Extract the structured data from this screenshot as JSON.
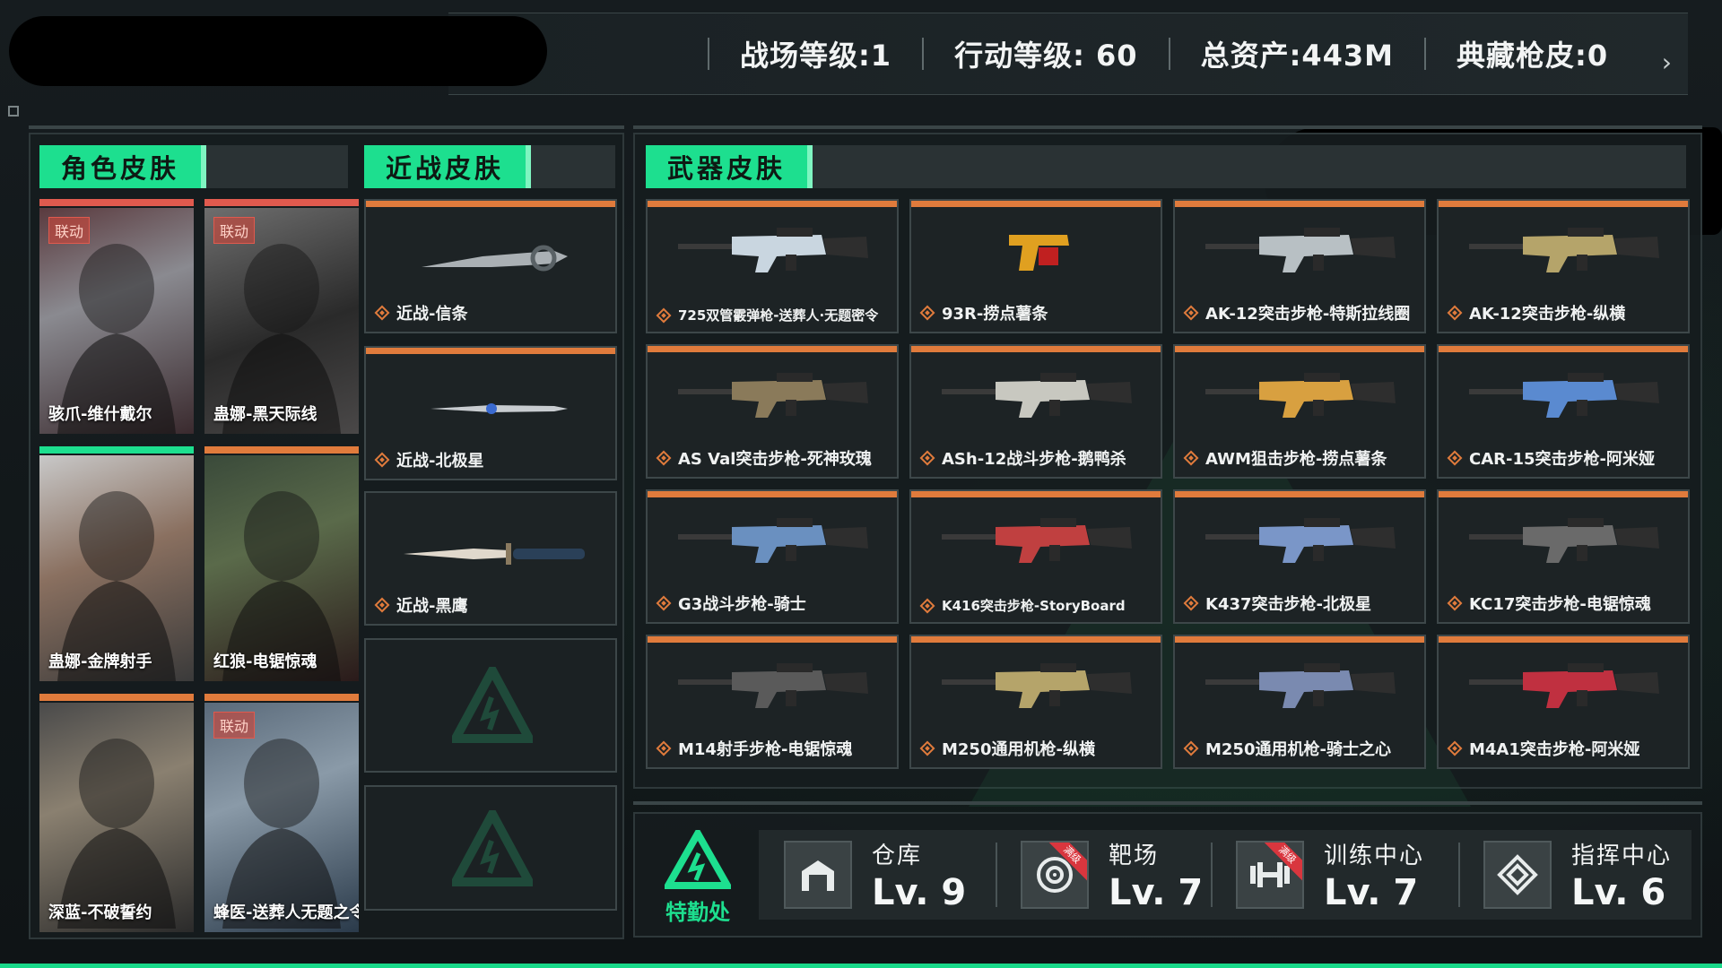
{
  "top_stats": [
    {
      "label": "战场等级:1"
    },
    {
      "label": "行动等级: 60"
    },
    {
      "label": "总资产:443M"
    },
    {
      "label": "典藏枪皮:0"
    }
  ],
  "sections": {
    "character": "角色皮肤",
    "melee": "近战皮肤",
    "weapon": "武器皮肤"
  },
  "characters": [
    {
      "name": "骇爪-维什戴尔",
      "badge": "联动",
      "strip": "#e05a4e"
    },
    {
      "name": "蛊娜-黑天际线",
      "badge": "联动",
      "strip": "#e05a4e"
    },
    {
      "name": "蛊娜-金牌射手",
      "badge": "",
      "strip": "#1ddf8f"
    },
    {
      "name": "红狼-电锯惊魂",
      "badge": "",
      "strip": "#e07b3c"
    },
    {
      "name": "深蓝-不破誓约",
      "badge": "",
      "strip": "#e07b3c"
    },
    {
      "name": "蜂医-送葬人无题之令",
      "badge": "联动",
      "strip": "#e07b3c"
    }
  ],
  "melee": [
    {
      "name": "近战-信条"
    },
    {
      "name": "近战-北极星"
    },
    {
      "name": "近战-黑鹰"
    }
  ],
  "weapons": [
    {
      "name": "725双管霰弹枪-送葬人·无题密令",
      "color": "#c9d6e0"
    },
    {
      "name": "93R-捞点薯条",
      "color": "#e0a020"
    },
    {
      "name": "AK-12突击步枪-特斯拉线圈",
      "color": "#b8c0c4"
    },
    {
      "name": "AK-12突击步枪-纵横",
      "color": "#b5a46a"
    },
    {
      "name": "AS Val突击步枪-死神玫瑰",
      "color": "#8a7a5a"
    },
    {
      "name": "ASh-12战斗步枪-鹅鸭杀",
      "color": "#c8c8c0"
    },
    {
      "name": "AWM狙击步枪-捞点薯条",
      "color": "#d8a040"
    },
    {
      "name": "CAR-15突击步枪-阿米娅",
      "color": "#5a8ad0"
    },
    {
      "name": "G3战斗步枪-骑士",
      "color": "#6a90c0"
    },
    {
      "name": "K416突击步枪-StoryBoard",
      "color": "#c04040"
    },
    {
      "name": "K437突击步枪-北极星",
      "color": "#7a96c8"
    },
    {
      "name": "KC17突击步枪-电锯惊魂",
      "color": "#6a6a6a"
    },
    {
      "name": "M14射手步枪-电锯惊魂",
      "color": "#5a5a5a"
    },
    {
      "name": "M250通用机枪-纵横",
      "color": "#b5a46a"
    },
    {
      "name": "M250通用机枪-骑士之心",
      "color": "#7a8ab0"
    },
    {
      "name": "M4A1突击步枪-阿米娅",
      "color": "#c03040"
    }
  ],
  "department": {
    "label": "特勤处"
  },
  "facilities": [
    {
      "name": "仓库",
      "level": "Lv. 9",
      "icon": "warehouse-icon",
      "ribbon": ""
    },
    {
      "name": "靶场",
      "level": "Lv. 7",
      "icon": "target-icon",
      "ribbon": "满级"
    },
    {
      "name": "训练中心",
      "level": "Lv. 7",
      "icon": "dumbbell-icon",
      "ribbon": "满级"
    },
    {
      "name": "指挥中心",
      "level": "Lv. 6",
      "icon": "command-icon",
      "ribbon": ""
    }
  ],
  "colors": {
    "accent": "#1ddf8f",
    "orange": "#e07b3c",
    "link_red": "#e05a4e"
  }
}
